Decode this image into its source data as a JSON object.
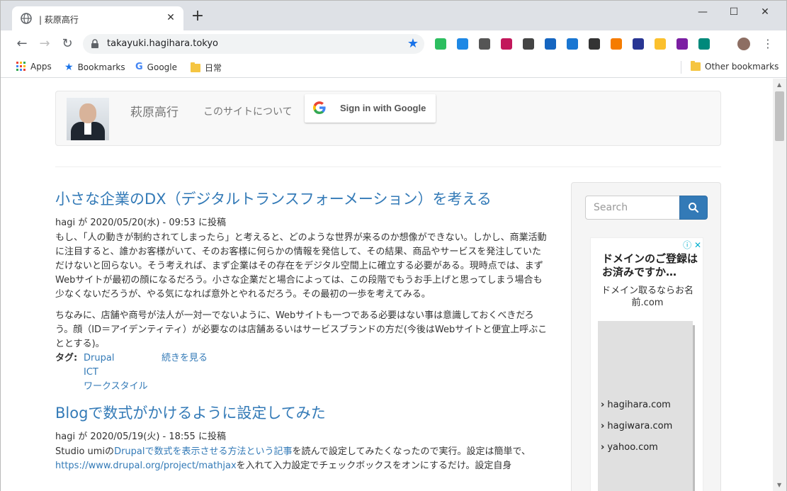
{
  "browser": {
    "tab_title": "| 萩原高行",
    "tab_close": "✕",
    "new_tab": "+",
    "url": "takayuki.hagihara.tokyo",
    "window_controls": {
      "minimize": "—",
      "maximize": "☐",
      "close": "✕"
    },
    "extensions": [
      {
        "name": "evernote-extension-icon",
        "color": "#2dbe60"
      },
      {
        "name": "edge-extension-icon",
        "color": "#1e88e5"
      },
      {
        "name": "circle-extension-icon",
        "color": "#555555"
      },
      {
        "name": "color-extension-icon",
        "color": "#c2185b"
      },
      {
        "name": "mail-extension-icon",
        "color": "#444444"
      },
      {
        "name": "id-extension-icon",
        "color": "#1565c0"
      },
      {
        "name": "triangle-extension-icon",
        "color": "#1976d2"
      },
      {
        "name": "key-extension-icon",
        "color": "#333333"
      },
      {
        "name": "rocket-extension-icon",
        "color": "#f57c00"
      },
      {
        "name": "clipboard-extension-icon",
        "color": "#283593"
      },
      {
        "name": "hand-extension-icon",
        "color": "#fbc02d"
      },
      {
        "name": "onenote-extension-icon",
        "color": "#7b1fa2"
      },
      {
        "name": "a-extension-icon",
        "color": "#00897b"
      }
    ]
  },
  "bookmarks": {
    "apps": "Apps",
    "bookmarks": "Bookmarks",
    "google": "Google",
    "folder1": "日常",
    "other": "Other bookmarks"
  },
  "site": {
    "brand": "萩原高行",
    "about": "このサイトについて",
    "google_signin": "Sign in with Google"
  },
  "articles": [
    {
      "title": "小さな企業のDX（デジタルトランスフォーメーション）を考える",
      "meta": "hagi が 2020/05/20(水) - 09:53 に投稿",
      "paragraphs": [
        "もし、「人の動きが制約されてしまったら」と考えると、どのような世界が来るのか想像ができない。しかし、商業活動に注目すると、誰かお客様がいて、そのお客様に何らかの情報を発信して、その結果、商品やサービスを発注していただけないと回らない。そう考えれば、まず企業はその存在をデジタル空間上に確立する必要がある。現時点では、まずWebサイトが最初の顔になるだろう。小さな企業だと場合によっては、この段階でもうお手上げと思ってしまう場合も少なくないだろうが、やる気になれば意外とやれるだろう。その最初の一歩を考えてみる。",
        "ちなみに、店舗や商号が法人が一対一でないように、Webサイトも一つである必要はない事は意識しておくべきだろう。顔（ID＝アイデンティティ）が必要なのは店舗あるいはサービスブランドの方だ(今後はWebサイトと便宜上呼ぶこととする)。"
      ],
      "tags_label": "タグ:",
      "tags": [
        "Drupal",
        "ICT",
        "ワークスタイル"
      ],
      "read_more": "続きを見る"
    },
    {
      "title": "Blogで数式がかけるように設定してみた",
      "meta": "hagi が 2020/05/19(火) - 18:55 に投稿",
      "p_prefix": "Studio umiの",
      "p_link": "Drupalで数式を表示させる方法という記事",
      "p_suffix": "を読んで設定してみたくなったので実行。設定は簡単で、",
      "p_link2": "https://www.drupal.org/project/mathjax",
      "p_suffix2": "を入れて入力設定でチェックボックスをオンにするだけ。設定自身"
    }
  ],
  "sidebar": {
    "search_placeholder": "Search",
    "ad": {
      "info": "ⓘ ✕",
      "headline": "ドメインのご登録はお済みですか…",
      "sub": "ドメイン取るならお名前.com",
      "links": [
        "hagihara.com",
        "hagiwara.com",
        "yahoo.com"
      ]
    }
  }
}
